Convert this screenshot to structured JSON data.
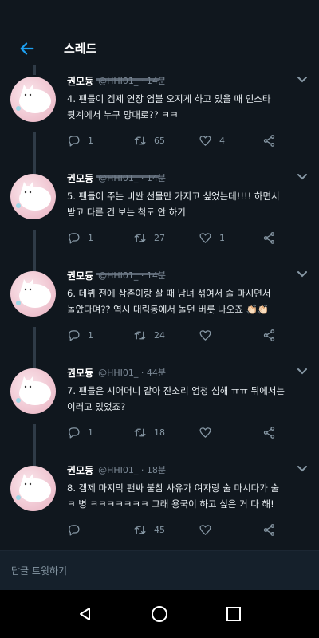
{
  "header": {
    "title": "스레드"
  },
  "tweets": [
    {
      "name": "권모듕",
      "handle": "@HHI01_ · 14분",
      "text_line1": "4. 팬들이 겜제 연장 염불 오지게 하고 있을 때 인스타",
      "text_line2": "뒷계에서 누구 망대로?? ㅋㅋ",
      "replies": "1",
      "retweets": "65",
      "likes": "4"
    },
    {
      "name": "권모듕",
      "handle": "@HHI01_ · 14분",
      "text_line1": "5. 팬들이 주는 비싼 선물만 가지고 싶었는데!!!! 하면서",
      "text_line2": "받고 다른 건 보는 척도 안 하기",
      "replies": "1",
      "retweets": "27",
      "likes": "1"
    },
    {
      "name": "권모듕",
      "handle": "@HHI01_ · 14분",
      "text_line1": "6. 데뷔 전에 삼촌이랑 살 때 남녀 섞여서 술 마시면서",
      "text_line2": "놀았다며?? 역시 대림동에서 놀던 버릇 나오죠 👏🏻👏🏻",
      "replies": "1",
      "retweets": "24",
      "likes": ""
    },
    {
      "name": "권모듕",
      "handle": "@HHI01_ · 44분",
      "text_line1": "7. 팬들은 시어머니 같아 잔소리 엄청 심해 ㅠㅠ 뒤에서는",
      "text_line2": "이러고 있었죠?",
      "replies": "1",
      "retweets": "18",
      "likes": ""
    },
    {
      "name": "권모듕",
      "handle": "@HHI01_ · 18분",
      "text_line1": "8. 겜제 마지막 팬싸 불참 사유가 여자랑 술 마시다가 술",
      "text_line2": "ㅋ 병 ㅋㅋㅋㅋㅋㅋㅋ 그래 용국이 하고 싶은 거 다 해!",
      "replies": "",
      "retweets": "45",
      "likes": ""
    }
  ],
  "reply_bar": {
    "placeholder": "답글 트윗하기"
  },
  "icons": {
    "back": "arrow-left-icon",
    "more": "chevron-down-icon",
    "reply": "reply-icon",
    "retweet": "retweet-icon",
    "like": "heart-icon",
    "share": "share-icon",
    "nav_back": "triangle-back-icon",
    "nav_home": "circle-home-icon",
    "nav_recents": "square-recents-icon"
  },
  "colors": {
    "accent": "#1da1f2",
    "background": "#10171e",
    "muted": "#8899a6"
  }
}
